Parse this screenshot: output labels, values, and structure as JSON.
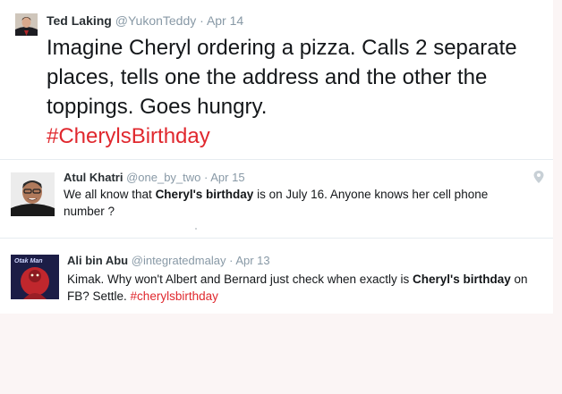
{
  "tweets": [
    {
      "name": "Ted Laking",
      "handle": "@YukonTeddy",
      "sep": "·",
      "date": "Apr 14",
      "text": "Imagine Cheryl ordering a pizza. Calls 2 separate places, tells one the address and the other the toppings. Goes hungry.",
      "hashtag": "#CherylsBirthday"
    },
    {
      "name": "Atul Khatri",
      "handle": "@one_by_two",
      "sep": "·",
      "date": "Apr 15",
      "text_a": "We all know that ",
      "bold": "Cheryl's birthday",
      "text_b": " is on July 16. Anyone knows her cell phone number ?"
    },
    {
      "name": "Ali bin Abu",
      "handle": "@integratedmalay",
      "sep": "·",
      "date": "Apr 13",
      "text_a": "Kimak. Why won't Albert and Bernard just check when exactly is ",
      "bold_a": "Cheryl's birthday",
      "text_b": " on FB? Settle. ",
      "hashtag": "#cherylsbirthday",
      "avatar_caption": "Otak Man"
    }
  ],
  "colors": {
    "hashtag": "#e0282e",
    "muted": "#8899a6",
    "background": "#fbf5f5"
  },
  "icons": [
    "pin-icon"
  ]
}
